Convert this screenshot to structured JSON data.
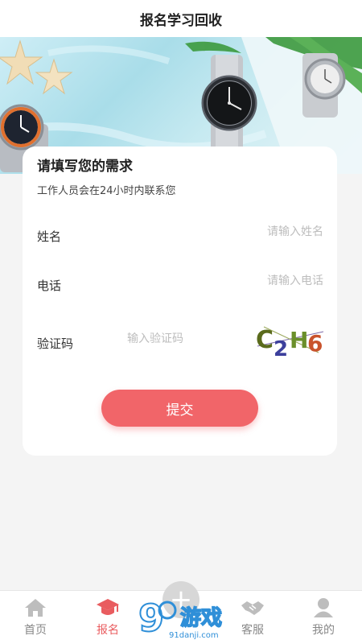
{
  "header": {
    "title": "报名学习回收"
  },
  "form": {
    "title": "请填写您的需求",
    "subtitle": "工作人员会在24小时内联系您",
    "name_label": "姓名",
    "name_placeholder": "请输入姓名",
    "phone_label": "电话",
    "phone_placeholder": "请输入电话",
    "captcha_label": "验证码",
    "captcha_placeholder": "输入验证码",
    "captcha_text": "C2H6",
    "submit_label": "提交"
  },
  "tabs": [
    {
      "label": "首页",
      "icon": "home-icon",
      "active": false
    },
    {
      "label": "报名",
      "icon": "graduation-cap-icon",
      "active": true
    },
    {
      "label": "客服",
      "icon": "handshake-icon",
      "active": false
    },
    {
      "label": "我的",
      "icon": "user-icon",
      "active": false
    }
  ],
  "center_action": {
    "icon": "plus-icon"
  },
  "watermark": {
    "main": "9",
    "sub": "游戏",
    "url": "91danji.com"
  },
  "colors": {
    "accent": "#f16569",
    "active_tab": "#e95c5f",
    "page_bg": "#f4f4f4"
  }
}
